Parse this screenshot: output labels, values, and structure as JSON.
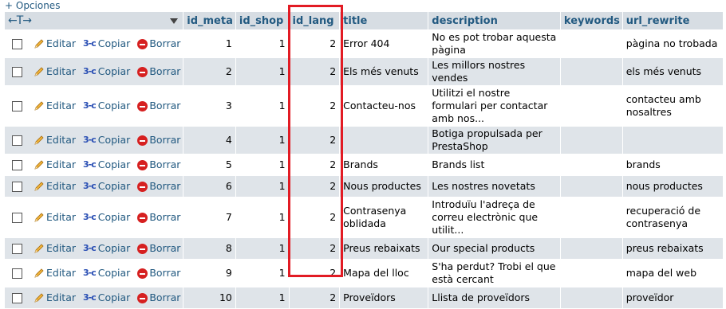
{
  "top": {
    "options_label": "+ Opciones"
  },
  "header": {
    "arrows": "←T→",
    "columns": [
      "id_meta",
      "id_shop",
      "id_lang",
      "title",
      "description",
      "keywords",
      "url_rewrite"
    ]
  },
  "actions": {
    "edit": "Editar",
    "copy": "Copiar",
    "delete": "Borrar",
    "copy_glyph": "3-c"
  },
  "rows": [
    {
      "id_meta": "1",
      "id_shop": "1",
      "id_lang": "2",
      "title": "Error 404",
      "description": "No es pot trobar aquesta pàgina",
      "keywords": "",
      "url_rewrite": "pàgina no trobada"
    },
    {
      "id_meta": "2",
      "id_shop": "1",
      "id_lang": "2",
      "title": "Els més venuts",
      "description": "Les millors nostres vendes",
      "keywords": "",
      "url_rewrite": "els més venuts"
    },
    {
      "id_meta": "3",
      "id_shop": "1",
      "id_lang": "2",
      "title": "Contacteu-nos",
      "description": "Utilitzi el nostre formulari per contactar amb nos...",
      "keywords": "",
      "url_rewrite": "contacteu amb nosaltres"
    },
    {
      "id_meta": "4",
      "id_shop": "1",
      "id_lang": "2",
      "title": "",
      "description": "Botiga propulsada per PrestaShop",
      "keywords": "",
      "url_rewrite": ""
    },
    {
      "id_meta": "5",
      "id_shop": "1",
      "id_lang": "2",
      "title": "Brands",
      "description": "Brands list",
      "keywords": "",
      "url_rewrite": "brands"
    },
    {
      "id_meta": "6",
      "id_shop": "1",
      "id_lang": "2",
      "title": "Nous productes",
      "description": "Les nostres novetats",
      "keywords": "",
      "url_rewrite": "nous productes"
    },
    {
      "id_meta": "7",
      "id_shop": "1",
      "id_lang": "2",
      "title": "Contrasenya oblidada",
      "description": "Introduïu l'adreça de correu electrònic que utilit...",
      "keywords": "",
      "url_rewrite": "recuperació de contrasenya"
    },
    {
      "id_meta": "8",
      "id_shop": "1",
      "id_lang": "2",
      "title": "Preus rebaixats",
      "description": "Our special products",
      "keywords": "",
      "url_rewrite": "preus rebaixats"
    },
    {
      "id_meta": "9",
      "id_shop": "1",
      "id_lang": "2",
      "title": "Mapa del lloc",
      "description": "S'ha perdut? Trobi el que està cercant",
      "keywords": "",
      "url_rewrite": "mapa del web"
    },
    {
      "id_meta": "10",
      "id_shop": "1",
      "id_lang": "2",
      "title": "Proveïdors",
      "description": "Llista de proveïdors",
      "keywords": "",
      "url_rewrite": "proveïdor"
    }
  ],
  "colors": {
    "highlight": "#e21b24",
    "header_bg": "#d7dde3",
    "row_even": "#dfe4e9",
    "link": "#235a81"
  }
}
